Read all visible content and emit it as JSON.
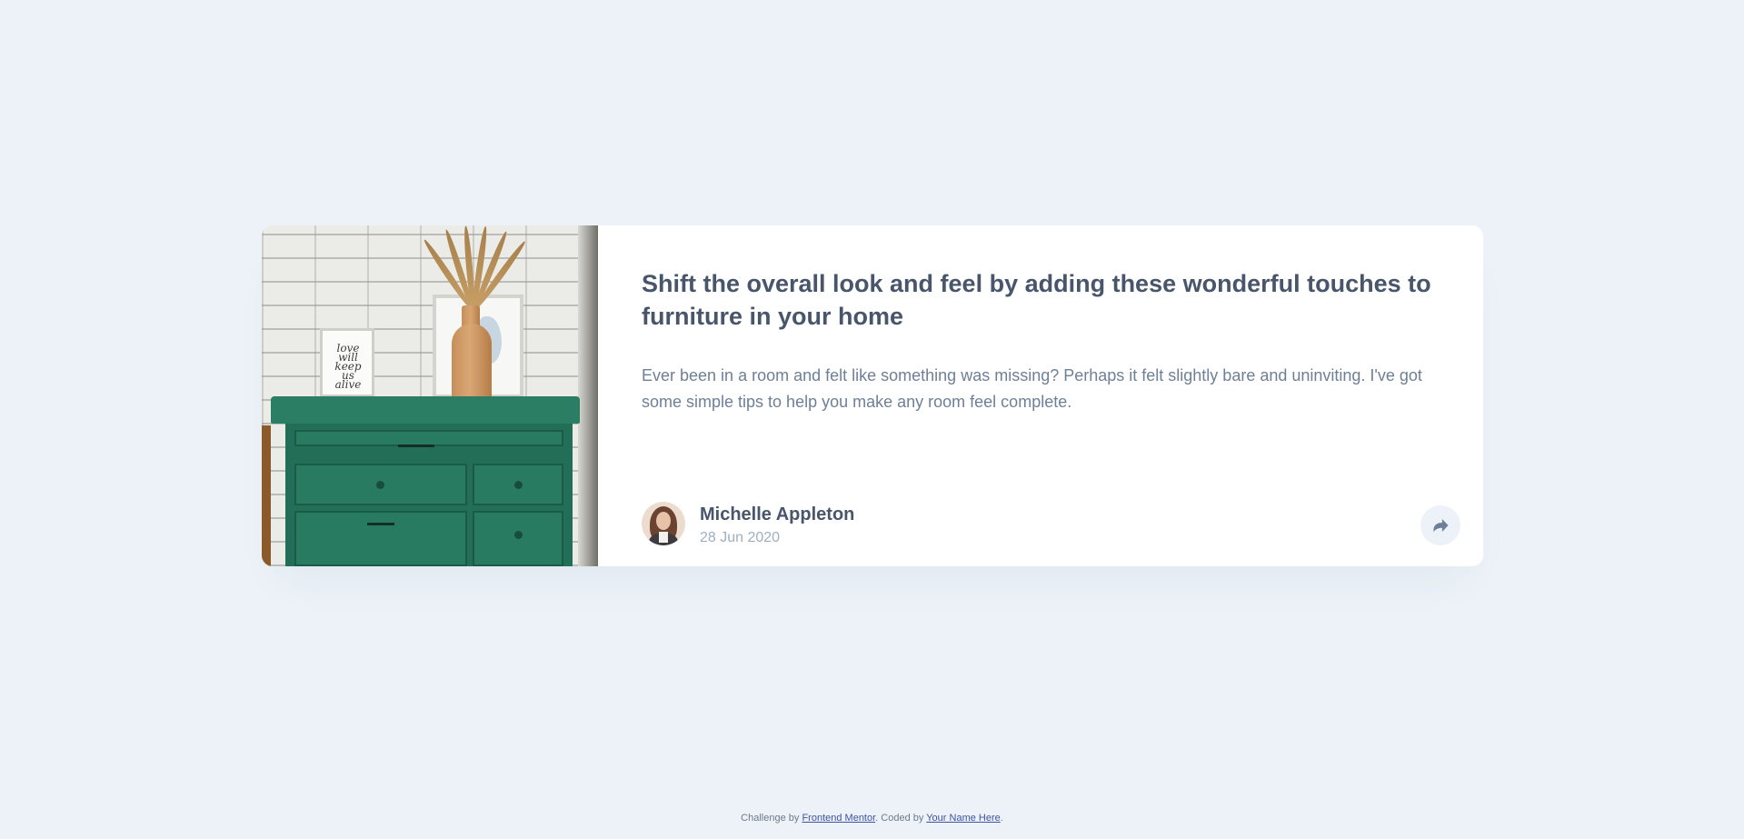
{
  "article": {
    "title": "Shift the overall look and feel by adding these wonderful touches to furniture in your home",
    "description": "Ever been in a room and felt like something was missing? Perhaps it felt slightly bare and uninviting. I've got some simple tips to help you make any room feel complete.",
    "image_frame_text": "love will keep us alive"
  },
  "author": {
    "name": "Michelle Appleton",
    "date": "28 Jun 2020"
  },
  "share": {
    "icon": "share-icon"
  },
  "attribution": {
    "prefix": "Challenge by ",
    "challenge_link": "Frontend Mentor",
    "middle": ". Coded by ",
    "coder_link": "Your Name Here",
    "suffix": "."
  },
  "colors": {
    "background": "#ecf2f8",
    "card": "#ffffff",
    "heading": "#48556a",
    "body_text": "#6e8098",
    "muted": "#9eafc2",
    "link": "#3e52a3",
    "share_bg": "#ecf2f8",
    "share_icon": "#6e8098"
  }
}
